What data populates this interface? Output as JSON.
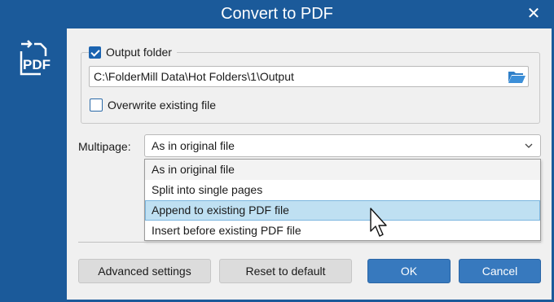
{
  "window": {
    "title": "Convert to PDF",
    "close_glyph": "✕",
    "accent_color": "#1b5a9a",
    "app_icon": "convert-to-pdf-icon",
    "app_icon_text": "PDF"
  },
  "output_group": {
    "checkbox_label": "Output folder",
    "checked": true,
    "folder_path": "C:\\FolderMill Data\\Hot Folders\\1\\Output",
    "browse_icon": "folder-open-icon",
    "overwrite_label": "Overwrite existing file",
    "overwrite_checked": false
  },
  "multipage": {
    "label": "Multipage:",
    "selected_value": "As in original file",
    "options": [
      "As in original file",
      "Split into single pages",
      "Append to existing PDF file",
      "Insert before existing PDF file"
    ],
    "hovered_option": "Append to existing PDF file"
  },
  "buttons": {
    "advanced": "Advanced settings",
    "reset": "Reset to default",
    "ok": "OK",
    "cancel": "Cancel"
  }
}
